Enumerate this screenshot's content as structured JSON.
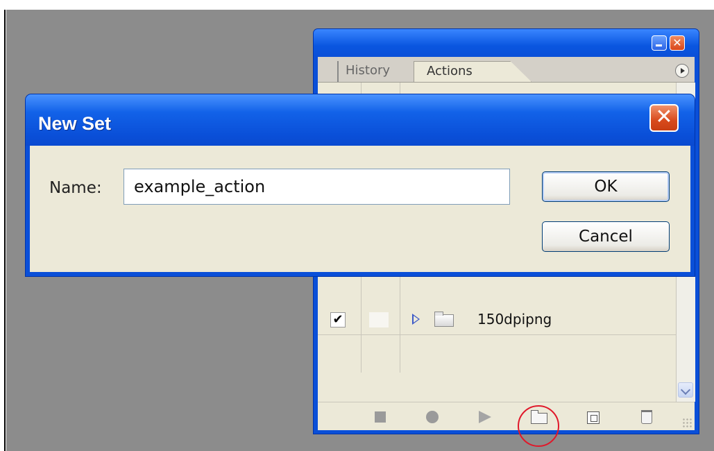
{
  "panel": {
    "tabs": [
      {
        "label": "History"
      },
      {
        "label": "Actions"
      }
    ],
    "rows": [
      {
        "label": "150dpipng",
        "checked": true,
        "check_glyph": "✔"
      }
    ],
    "toolbar": {
      "icons": [
        "stop-icon",
        "record-icon",
        "play-icon",
        "new-set-icon",
        "new-action-icon",
        "trash-icon"
      ]
    },
    "close_glyph": "✕"
  },
  "dialog": {
    "title": "New Set",
    "close_glyph": "✕",
    "name_label": "Name:",
    "name_value": "example_action",
    "ok_label": "OK",
    "cancel_label": "Cancel"
  },
  "colors": {
    "titlebar_blue": "#0a4fd8",
    "dialog_body": "#ece9d8",
    "close_orange": "#d84a1c",
    "highlight_red": "#e0182a"
  }
}
